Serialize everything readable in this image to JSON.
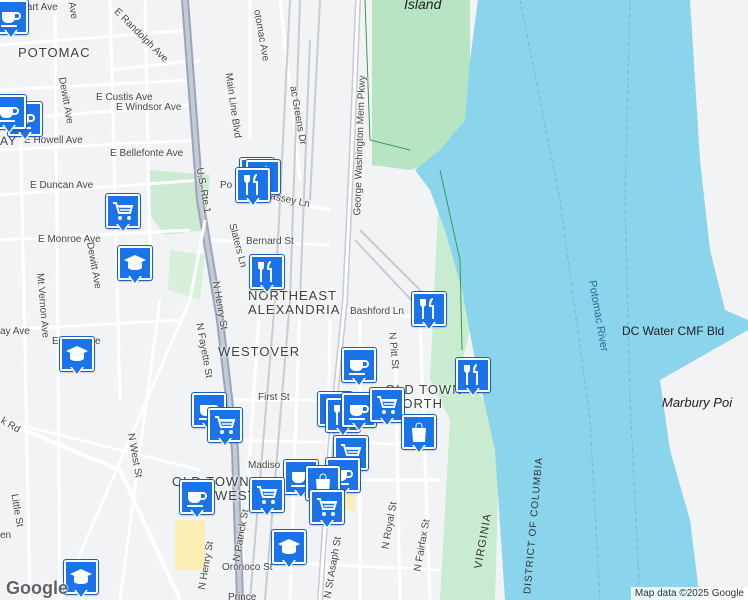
{
  "labels": {
    "neighborhoods": [
      "POTOMAC",
      "NORTHEAST",
      "ALEXANDRIA",
      "WESTOVER",
      "OLD TOWN",
      "NORTH",
      "OLD TOWN",
      "WEST",
      "AY"
    ],
    "streets": [
      "ewart Ave",
      "Ave",
      "E Randolph Ave",
      "otomac Ave",
      "E Custis Ave",
      "Dewitt Ave",
      "E Windsor Ave",
      "Main Line Blvd",
      "ac Greens Dr",
      "E Howell Ave",
      "E Bellefonte Ave",
      "U.S. Rte 1",
      "Po",
      "E Duncan Ave",
      "assey Ln",
      "E Monroe Ave",
      "Slaters Ln",
      "Bernard St",
      "Dewitt Ave",
      "Mt Vernon Ave",
      "N Henry St",
      "George Washington Mem Pkwy",
      "Bashford Ln",
      "ay Ave",
      "E",
      "ve",
      "N Fayette St",
      "N West St",
      "N Pitt St",
      "First St",
      "k Rd",
      "Madiso",
      "Little St",
      "en",
      "N Henry St",
      "N Patrick St",
      "N St Asaph St",
      "N Royal St",
      "N Fairfax St",
      "Oronoco St",
      "Prince"
    ],
    "water": "Potomac River",
    "island": "Island",
    "building": "DC Water CMF Bld",
    "point": "Marbury Poi",
    "virginia": "VIRGINIA",
    "dc": "DISTRICT OF COLUMBIA"
  },
  "markers": [
    {
      "type": "coffee-cup",
      "icon": "coffee-icon"
    },
    {
      "type": "restaurant",
      "icon": "fork-knife-icon"
    },
    {
      "type": "grocery",
      "icon": "cart-icon"
    },
    {
      "type": "school",
      "icon": "grad-cap-icon"
    },
    {
      "type": "shopping",
      "icon": "bag-icon"
    }
  ],
  "colors": {
    "pin": "#1a73e8",
    "water": "#8bd5ec",
    "park": "#b7e4c2",
    "road": "#ffffff",
    "highway": "#9aa5b8",
    "land": "#f1f3f4"
  },
  "logo": "Google",
  "attribution": "Map data ©2025 Google"
}
